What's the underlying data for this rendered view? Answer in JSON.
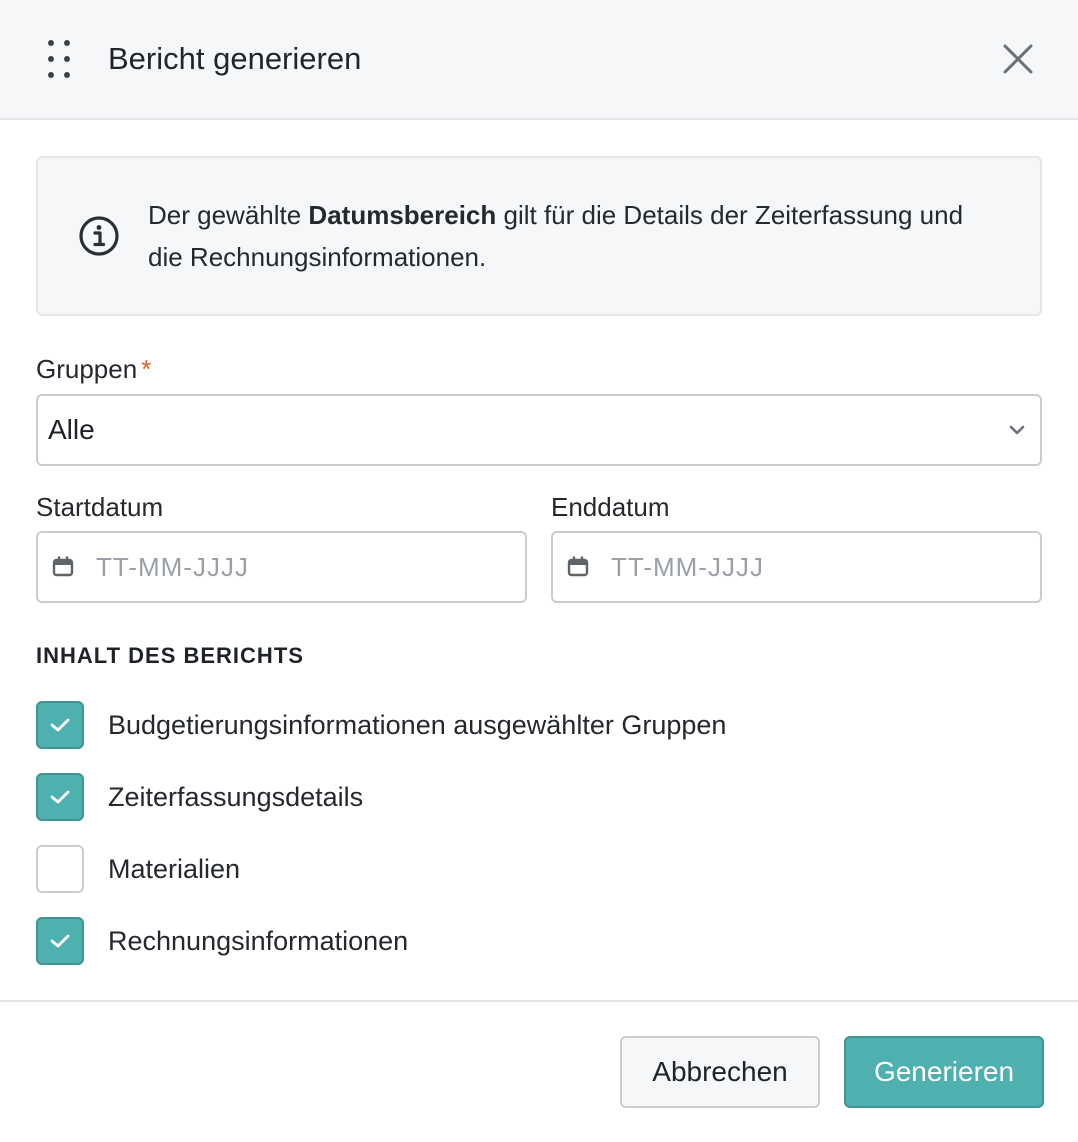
{
  "dialog": {
    "title": "Bericht generieren"
  },
  "info": {
    "text_before": "Der gewählte ",
    "text_bold": "Datumsbereich",
    "text_after": " gilt für die Details der Zeiterfassung und die Rechnungsinformationen."
  },
  "groups": {
    "label": "Gruppen",
    "required_marker": "*",
    "value": "Alle"
  },
  "start_date": {
    "label": "Startdatum",
    "placeholder": "TT-MM-JJJJ"
  },
  "end_date": {
    "label": "Enddatum",
    "placeholder": "TT-MM-JJJJ"
  },
  "report_content": {
    "title": "INHALT DES BERICHTS",
    "items": [
      {
        "label": "Budgetierungsinformationen ausgewählter Gruppen",
        "checked": true
      },
      {
        "label": "Zeiterfassungsdetails",
        "checked": true
      },
      {
        "label": "Materialien",
        "checked": false
      },
      {
        "label": "Rechnungsinformationen",
        "checked": true
      }
    ]
  },
  "buttons": {
    "cancel": "Abbrechen",
    "generate": "Generieren"
  },
  "colors": {
    "accent": "#4fb0b0",
    "required": "#e0642a"
  },
  "icons": {
    "drag": "drag-handle-icon",
    "close": "close-icon",
    "info": "info-icon",
    "chevron": "chevron-down-icon",
    "calendar": "calendar-icon",
    "check": "check-icon"
  }
}
